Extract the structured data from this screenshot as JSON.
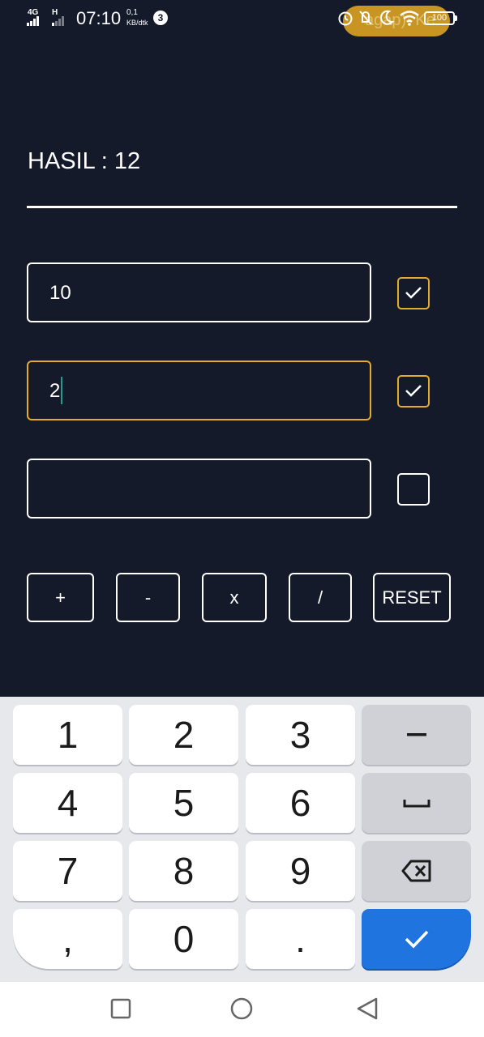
{
  "status_bar": {
    "network_1": "4G",
    "network_2": "H",
    "time": "07:10",
    "speed_value": "0,1",
    "speed_unit": "KB/dtk",
    "notification_count": "3",
    "pill_text": "agap): Ke",
    "battery": "100",
    "icons": [
      "alarm-icon",
      "mute-icon",
      "moon-icon",
      "wifi-icon",
      "battery-icon"
    ]
  },
  "app": {
    "result_label": "HASIL : 12",
    "inputs": [
      {
        "value": "10",
        "checked": true,
        "focused": false
      },
      {
        "value": "2",
        "checked": true,
        "focused": true
      },
      {
        "value": "",
        "checked": false,
        "focused": false
      }
    ],
    "buttons": {
      "add": "+",
      "subtract": "-",
      "multiply": "x",
      "divide": "/",
      "reset": "RESET"
    },
    "colors": {
      "background": "#141a2a",
      "accent": "#e3ac2a",
      "caret": "#1f9c8e"
    }
  },
  "keyboard": {
    "row1": [
      "1",
      "2",
      "3"
    ],
    "row2": [
      "4",
      "5",
      "6"
    ],
    "row3": [
      "7",
      "8",
      "9"
    ],
    "comma": ",",
    "zero": "0",
    "dot": ".",
    "fn_icons": [
      "minus-icon",
      "space-icon",
      "backspace-icon",
      "checkmark-icon"
    ],
    "done_color": "#1f74e0"
  },
  "navbar": {
    "icons": [
      "recents-square-icon",
      "home-circle-icon",
      "back-triangle-icon"
    ]
  }
}
